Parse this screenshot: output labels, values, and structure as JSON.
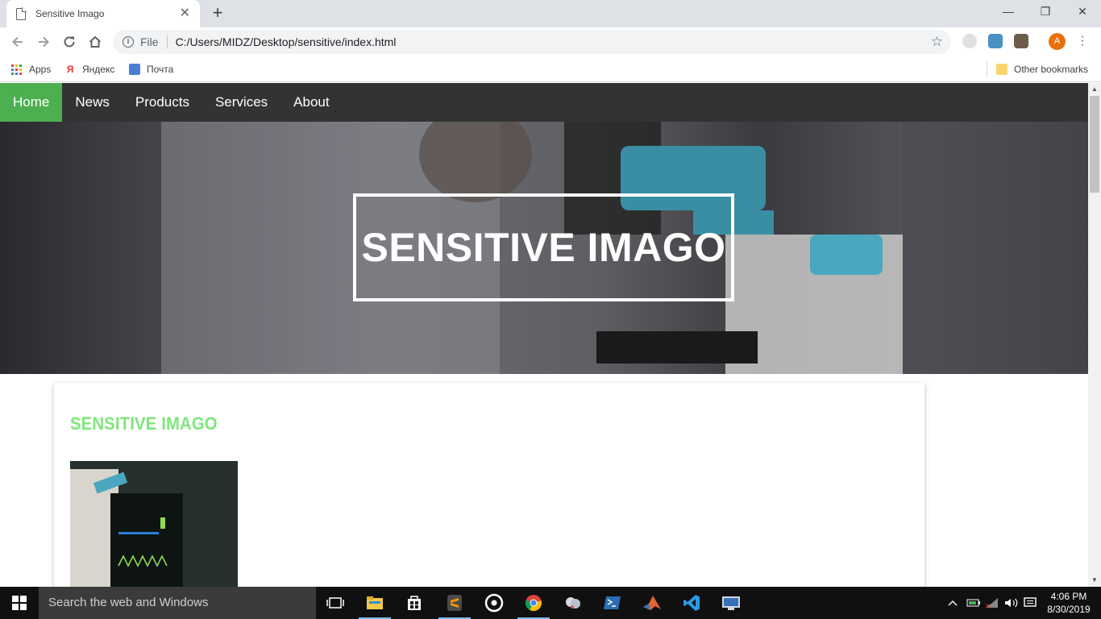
{
  "browser": {
    "tab_title": "Sensitive Imago",
    "new_tab_symbol": "+",
    "address_scheme": "File",
    "address_url": "C:/Users/MIDZ/Desktop/sensitive/index.html",
    "profile_initial": "A",
    "bookmarks": [
      {
        "label": "Apps"
      },
      {
        "label": "Яндекс"
      },
      {
        "label": "Почта"
      }
    ],
    "other_bookmarks": "Other bookmarks"
  },
  "site": {
    "nav": [
      {
        "label": "Home",
        "active": true
      },
      {
        "label": "News",
        "active": false
      },
      {
        "label": "Products",
        "active": false
      },
      {
        "label": "Services",
        "active": false
      },
      {
        "label": "About",
        "active": false
      }
    ],
    "hero_title": "SENSITIVE IMAGO",
    "card_title": "SENSITIVE IMAGO"
  },
  "taskbar": {
    "search_placeholder": "Search the web and Windows",
    "time": "4:06 PM",
    "date": "8/30/2019"
  },
  "colors": {
    "nav_bg": "#333333",
    "nav_active": "#4caf50",
    "card_title": "#7ee67c",
    "taskbar_bg": "#101010"
  }
}
